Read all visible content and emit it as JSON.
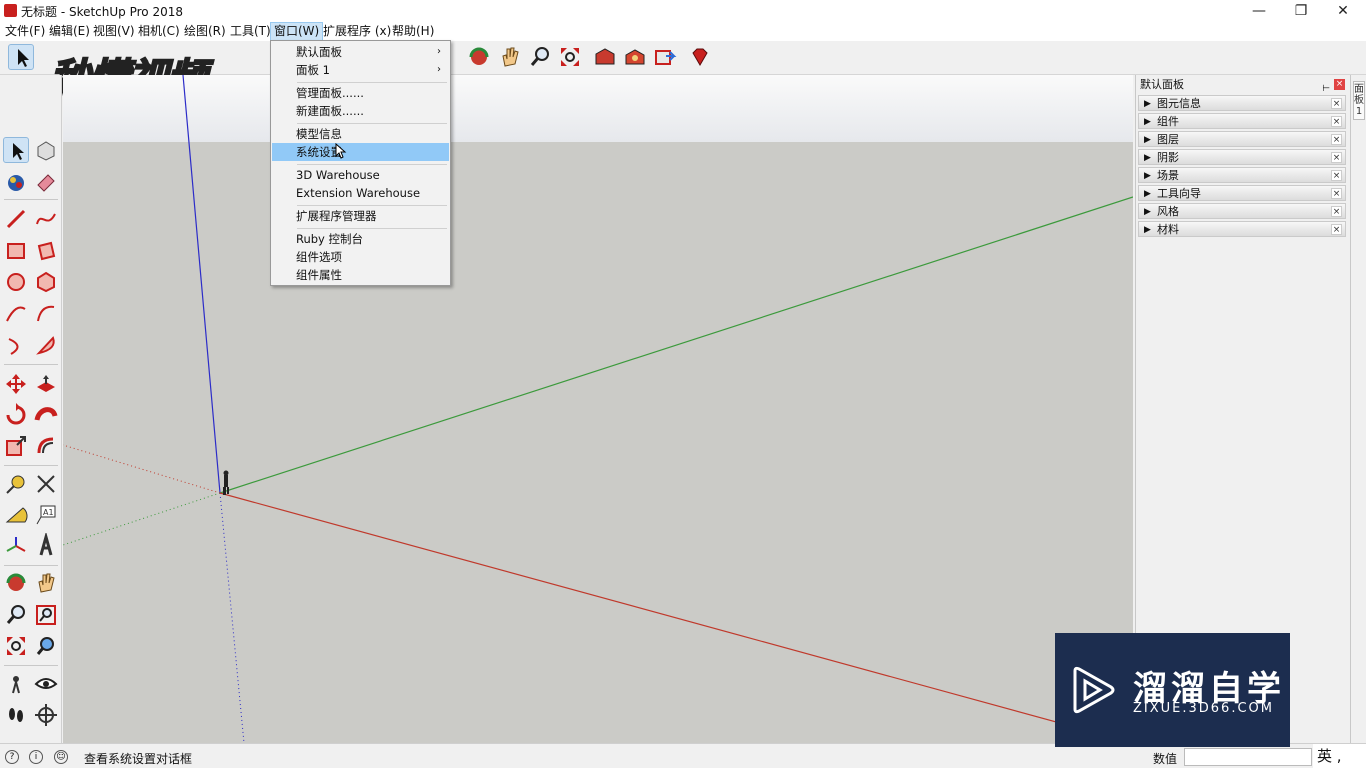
{
  "window": {
    "title": "无标题 - SketchUp Pro 2018",
    "controls": {
      "minimize": "—",
      "restore": "❐",
      "close": "✕"
    }
  },
  "menubar": {
    "items": [
      {
        "label": "文件(F)"
      },
      {
        "label": "编辑(E)"
      },
      {
        "label": "视图(V)"
      },
      {
        "label": "相机(C)"
      },
      {
        "label": "绘图(R)"
      },
      {
        "label": "工具(T)"
      },
      {
        "label": "窗口(W)",
        "active": true
      },
      {
        "label": "扩展程序 (x)"
      },
      {
        "label": "帮助(H)"
      }
    ]
  },
  "window_menu": {
    "items": [
      {
        "label": "默认面板",
        "submenu": true
      },
      {
        "label": "面板 1",
        "submenu": true
      },
      {
        "label": "管理面板......"
      },
      {
        "label": "新建面板......"
      },
      {
        "label": "模型信息"
      },
      {
        "label": "系统设置",
        "highlighted": true
      },
      {
        "label": "3D Warehouse"
      },
      {
        "label": "Extension Warehouse"
      },
      {
        "label": "扩展程序管理器"
      },
      {
        "label": "Ruby 控制台"
      },
      {
        "label": "组件选项"
      },
      {
        "label": "组件属性"
      }
    ],
    "submenu_arrow": "›"
  },
  "watermark_top": {
    "text": "秒懂视频"
  },
  "tray": {
    "title": "默认面板",
    "pin": "📌",
    "close": "×",
    "panels": [
      {
        "label": "图元信息"
      },
      {
        "label": "组件"
      },
      {
        "label": "图层"
      },
      {
        "label": "阴影"
      },
      {
        "label": "场景"
      },
      {
        "label": "工具向导"
      },
      {
        "label": "风格"
      },
      {
        "label": "材料"
      }
    ],
    "side_tab": "面板 1",
    "panel_expand_icon": "▶",
    "panel_close_icon": "×"
  },
  "statusbar": {
    "message": "查看系统设置对话框",
    "value_label": "数值",
    "ime": "英 ,"
  },
  "logo": {
    "name": "溜溜自学",
    "url": "ZIXUE.3D66.COM"
  },
  "colors": {
    "axis_red": "#c0392b",
    "axis_green": "#3c9a3c",
    "axis_blue": "#2c2cc8",
    "menu_highlight": "#91c9f7",
    "logo_bg": "#1c2d4f"
  }
}
